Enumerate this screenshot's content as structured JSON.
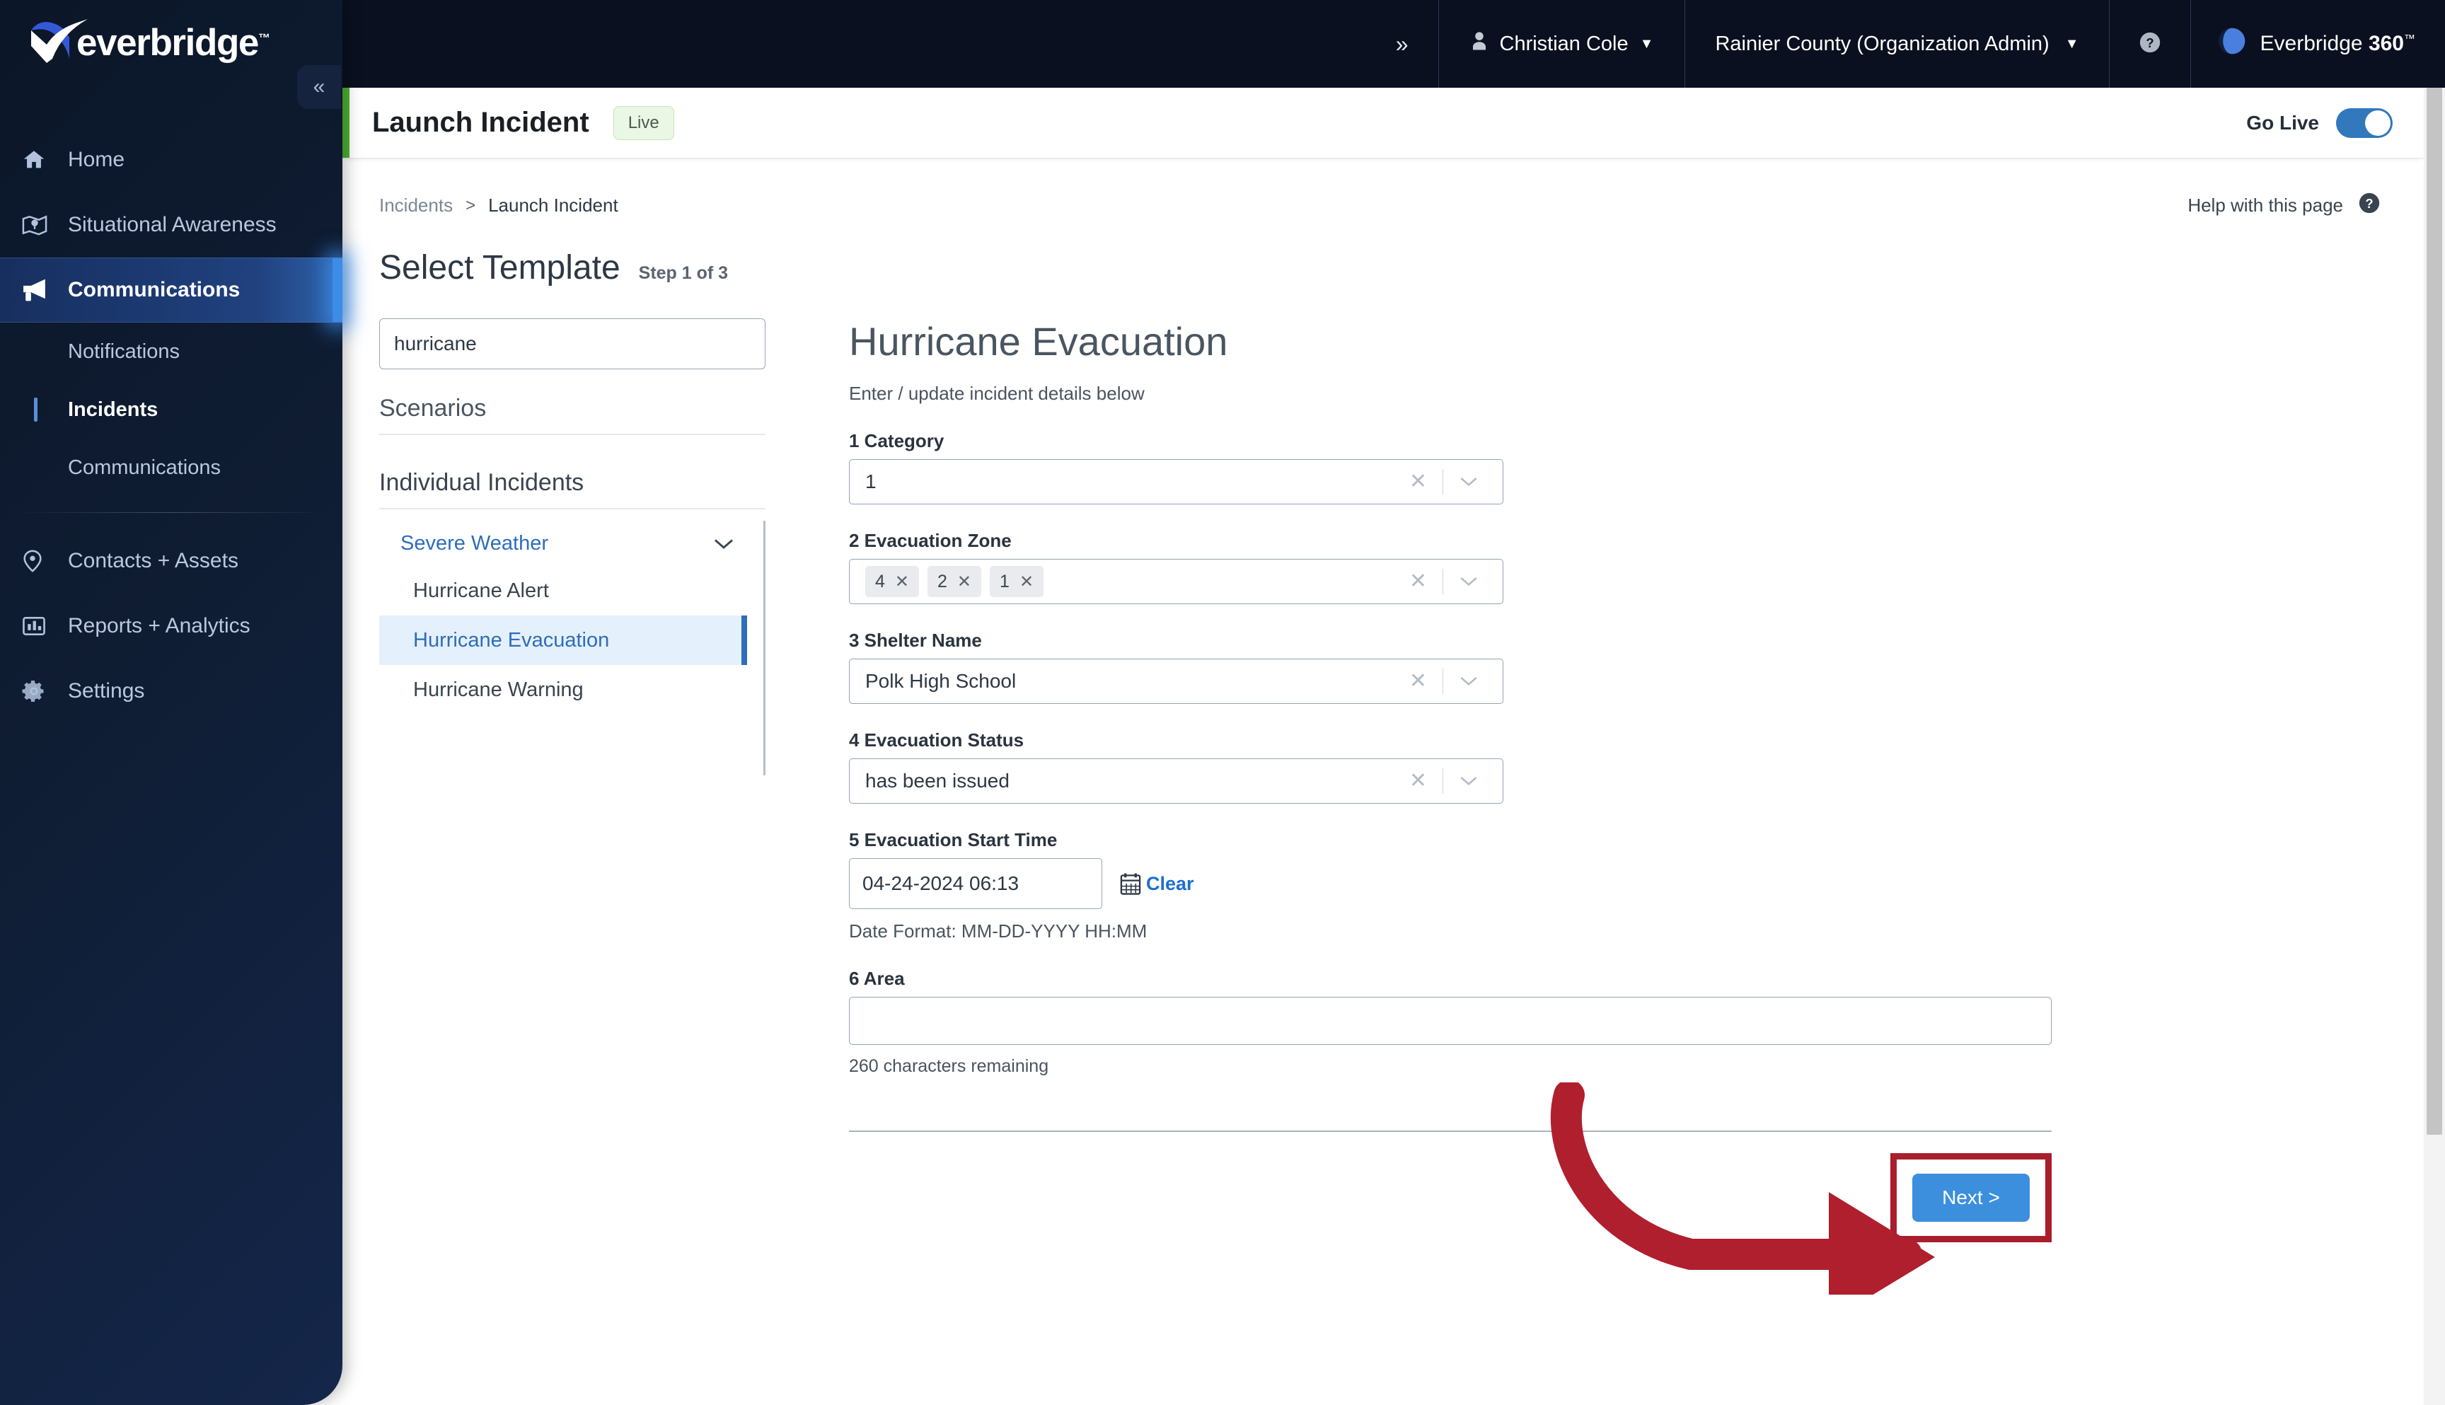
{
  "brand": {
    "name": "everbridge",
    "tm": "™"
  },
  "topbar": {
    "expand_icon": "chevron-double-right-icon",
    "user_name": "Christian Cole",
    "org_name": "Rainier County (Organization Admin)",
    "help_icon": "question-circle-icon",
    "product_prefix": "Everbridge ",
    "product_name": "360",
    "product_tm": "™"
  },
  "sidebar": {
    "collapse_icon": "chevron-double-left-icon",
    "items": [
      {
        "label": "Home",
        "icon": "home-icon"
      },
      {
        "label": "Situational Awareness",
        "icon": "map-pin-icon"
      },
      {
        "label": "Communications",
        "icon": "megaphone-icon"
      }
    ],
    "sub_items": [
      {
        "label": "Notifications"
      },
      {
        "label": "Incidents"
      },
      {
        "label": "Communications"
      }
    ],
    "bottom_items": [
      {
        "label": "Contacts + Assets",
        "icon": "location-pin-icon"
      },
      {
        "label": "Reports + Analytics",
        "icon": "chart-bar-icon"
      },
      {
        "label": "Settings",
        "icon": "gear-icon"
      }
    ]
  },
  "page_header": {
    "title": "Launch Incident",
    "badge": "Live",
    "go_live_label": "Go Live",
    "accent_color": "#4caf31"
  },
  "breadcrumb": {
    "parent": "Incidents",
    "separator": ">",
    "current": "Launch Incident"
  },
  "help": {
    "label": "Help with this page",
    "icon": "question-circle-icon"
  },
  "section": {
    "title": "Select Template",
    "step": "Step 1 of 3"
  },
  "templates": {
    "search_value": "hurricane",
    "search_placeholder": "Search templates",
    "scenarios_label": "Scenarios",
    "individual_label": "Individual Incidents",
    "category": {
      "label": "Severe Weather",
      "chevron": "chevron-down-icon"
    },
    "items": [
      {
        "label": "Hurricane Alert",
        "selected": false
      },
      {
        "label": "Hurricane Evacuation",
        "selected": true
      },
      {
        "label": "Hurricane Warning",
        "selected": false
      }
    ]
  },
  "form": {
    "title": "Hurricane Evacuation",
    "subtitle": "Enter / update incident details below",
    "category": {
      "label": "1 Category",
      "value": "1"
    },
    "evacuation_zone": {
      "label": "2 Evacuation Zone",
      "chips": [
        "4",
        "2",
        "1"
      ]
    },
    "shelter_name": {
      "label": "3 Shelter Name",
      "value": "Polk High School"
    },
    "evacuation_status": {
      "label": "4 Evacuation Status",
      "value": "has been issued"
    },
    "start_time": {
      "label": "5 Evacuation Start Time",
      "value": "04-24-2024 06:13",
      "clear_label": "Clear",
      "calendar_icon": "calendar-icon",
      "format_hint": "Date Format: MM-DD-YYYY HH:MM"
    },
    "area": {
      "label": "6 Area",
      "value": "",
      "char_count": "260 characters remaining"
    },
    "next_button": "Next >",
    "clear_icon": "close-x-icon",
    "dropdown_icon": "chevron-down-icon"
  },
  "annotation": {
    "arrow_color": "#b01f2e",
    "highlight_color": "#a91e2c"
  }
}
